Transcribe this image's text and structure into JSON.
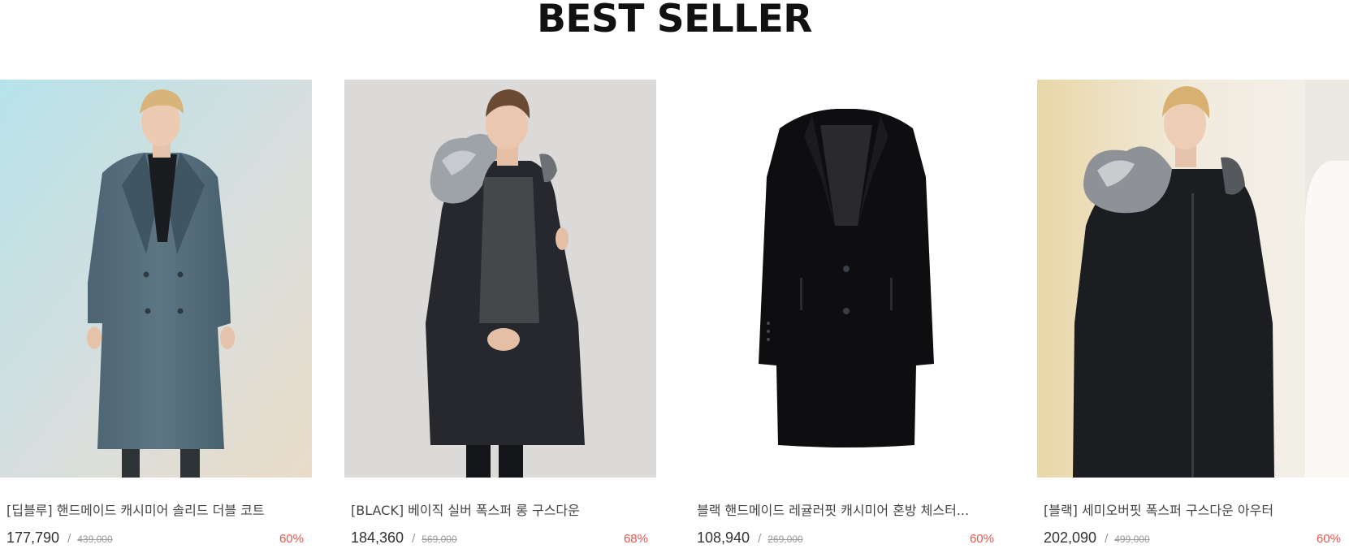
{
  "section": {
    "title": "BEST SELLER"
  },
  "products": [
    {
      "name": "[딥블루] 핸드메이드 캐시미어 솔리드 더블 코트",
      "price": "177,790",
      "original_price": "439,000",
      "discount": "60%",
      "image": "model-wearing-blue-grey-double-coat"
    },
    {
      "name": "[BLACK] 베이직 실버 폭스퍼 롱 구스다운",
      "price": "184,360",
      "original_price": "569,000",
      "discount": "68%",
      "image": "model-wearing-black-fur-hood-down-parka"
    },
    {
      "name": "블랙 핸드메이드 레귤러핏 캐시미어 혼방 체스터...",
      "price": "108,940",
      "original_price": "269,000",
      "discount": "60%",
      "image": "black-chester-coat-product-shot"
    },
    {
      "name": "[블랙] 세미오버핏 폭스퍼 구스다운 아우터",
      "price": "202,090",
      "original_price": "499,000",
      "discount": "60%",
      "image": "model-wearing-black-fox-fur-down-outer"
    }
  ],
  "price_separator": "/",
  "colors": {
    "discount": "#e8564f",
    "title": "#111111",
    "price": "#333333",
    "muted": "#999999"
  }
}
